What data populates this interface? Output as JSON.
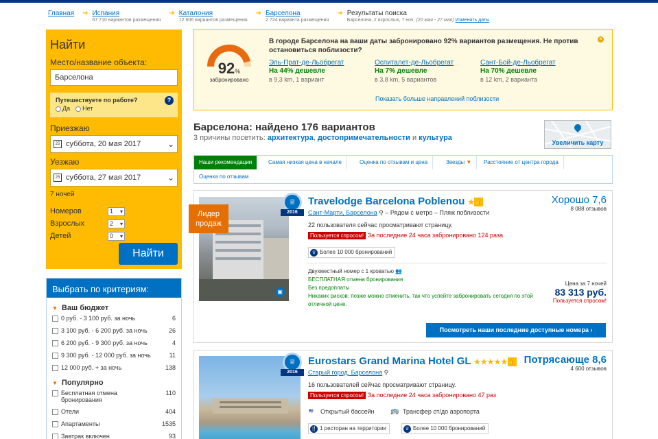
{
  "breadcrumb": [
    {
      "title": "Главная",
      "sub": ""
    },
    {
      "title": "Испания",
      "sub": "67 710 вариантов размещения"
    },
    {
      "title": "Каталония",
      "sub": "12 606 вариантов размещения"
    },
    {
      "title": "Барселона",
      "sub": "2 724 варианта размещения"
    },
    {
      "title": "Результаты поиска",
      "sub": "Барселона, 2 взрослых, 7 ноч.",
      "dates": "(20 мая - 27 мая)",
      "link": "Изменить даты"
    }
  ],
  "search": {
    "title": "Найти",
    "dest_label": "Место/название объекта:",
    "dest_value": "Барселона",
    "work_q": "Путешествуете по работе?",
    "yes": "Да",
    "no": "Нет",
    "checkin_label": "Приезжаю",
    "checkin": "суббота, 20 мая 2017",
    "checkout_label": "Уезжаю",
    "checkout": "суббота, 27 мая 2017",
    "nights": "7 ночей",
    "rooms_label": "Номеров",
    "rooms": "1",
    "adults_label": "Взрослых",
    "adults": "2",
    "kids_label": "Детей",
    "kids": "0",
    "button": "Найти"
  },
  "filters": {
    "title": "Выбрать по критериям:",
    "budget_title": "Ваш бюджет",
    "budget": [
      {
        "label": "0 руб. - 3 100 руб. за ночь",
        "count": "6"
      },
      {
        "label": "3 100 руб. - 6 200 руб. за ночь",
        "count": "26"
      },
      {
        "label": "6 200 руб. - 9 300 руб. за ночь",
        "count": "4"
      },
      {
        "label": "9 300 руб. - 12 000 руб. за ночь",
        "count": "11"
      },
      {
        "label": "12 000 руб. + за ночь",
        "count": "138"
      }
    ],
    "popular_title": "Популярно",
    "popular": [
      {
        "label": "Бесплатная отмена бронирования",
        "count": "110"
      },
      {
        "label": "Отели",
        "count": "404"
      },
      {
        "label": "Апартаменты",
        "count": "1535"
      },
      {
        "label": "Завтрак включен",
        "count": "93"
      }
    ]
  },
  "suggestion": {
    "percent": "92",
    "percent_sign": "%",
    "percent_value": 92,
    "booked": "забронировано",
    "message": "В городе Барселона на ваши даты забронировано 92% вариантов размещения. Не против остановиться поблизости?",
    "alternatives": [
      {
        "name": "Эль-Прат-де-Льобрегат",
        "cheaper": "На 44% дешевле",
        "details": "в 9,3 km, 1 вариант"
      },
      {
        "name": "Оспиталет-де-Льобрегат",
        "cheaper": "На 7% дешевле",
        "details": "в 3,8 km, 5 вариантов"
      },
      {
        "name": "Сант-Бой-де-Льобрегат",
        "cheaper": "На 70% дешевле",
        "details": "в 12 km, 2 варианта"
      }
    ],
    "more": "Показать больше направлений поблизости"
  },
  "results": {
    "heading": "Барселона: найдено 176 вариантов",
    "reasons_prefix": "3 причины посетить:",
    "reason1": "архитектура",
    "reason2": "достопримечательности",
    "and": "и",
    "reason3": "культура",
    "map_label": "Увеличить карту"
  },
  "tabs": [
    "Наши рекомендации",
    "Самая низкая цена в начале",
    "Оценка по отзывам и цена",
    "Звезды",
    "Расстояние от центра города",
    "Оценка по отзывам"
  ],
  "hotels": [
    {
      "name": "Travelodge Barcelona Poblenou",
      "leader": "Лидер продаж",
      "year": "2016",
      "district": "Сант-Марти, Барселона",
      "nearby": "– Рядом с метро – Пляж поблизости",
      "viewing": "22 пользователя сейчас просматривают страницу.",
      "demand_tag": "Пользуется спросом!",
      "demand_text": "За последние 24 часа забронировано 124 раза",
      "bookings": "Более 10 000 бронирований",
      "score_word": "Хорошо 7,6",
      "reviews": "8 088 отзывов",
      "room": "Двухместный номер с 1 кроватью",
      "free_cancel": "БЕСПЛАТНАЯ отмена бронирования",
      "no_prepay": "Без предоплаты",
      "no_risk": "Никаких рисков: позже можно отменить, так что успейте забронировать сегодня по этой отличной цене.",
      "price_label": "Цена за 7 ночей",
      "price": "83 313 руб.",
      "price_demand": "Пользуется спросом!",
      "cta": "Посмотреть наши последние доступные номера ›"
    },
    {
      "name": "Eurostars Grand Marina Hotel GL",
      "stars": "★★★★★",
      "year": "2016",
      "district": "Старый город, Барселона",
      "viewing": "16 пользователей сейчас просматривают страницу.",
      "demand_tag": "Пользуется спросом!",
      "demand_text": "За последние 24 часа забронировано 47 раз",
      "fac1": "Открытый бассейн",
      "fac2": "Трансфер от/до аэропорта",
      "restaurant": "1 ресторан на территории",
      "bookings": "Более 10 000 бронирований",
      "score_word": "Потрясающе 8,6",
      "reviews": "4 600 отзывов"
    }
  ]
}
